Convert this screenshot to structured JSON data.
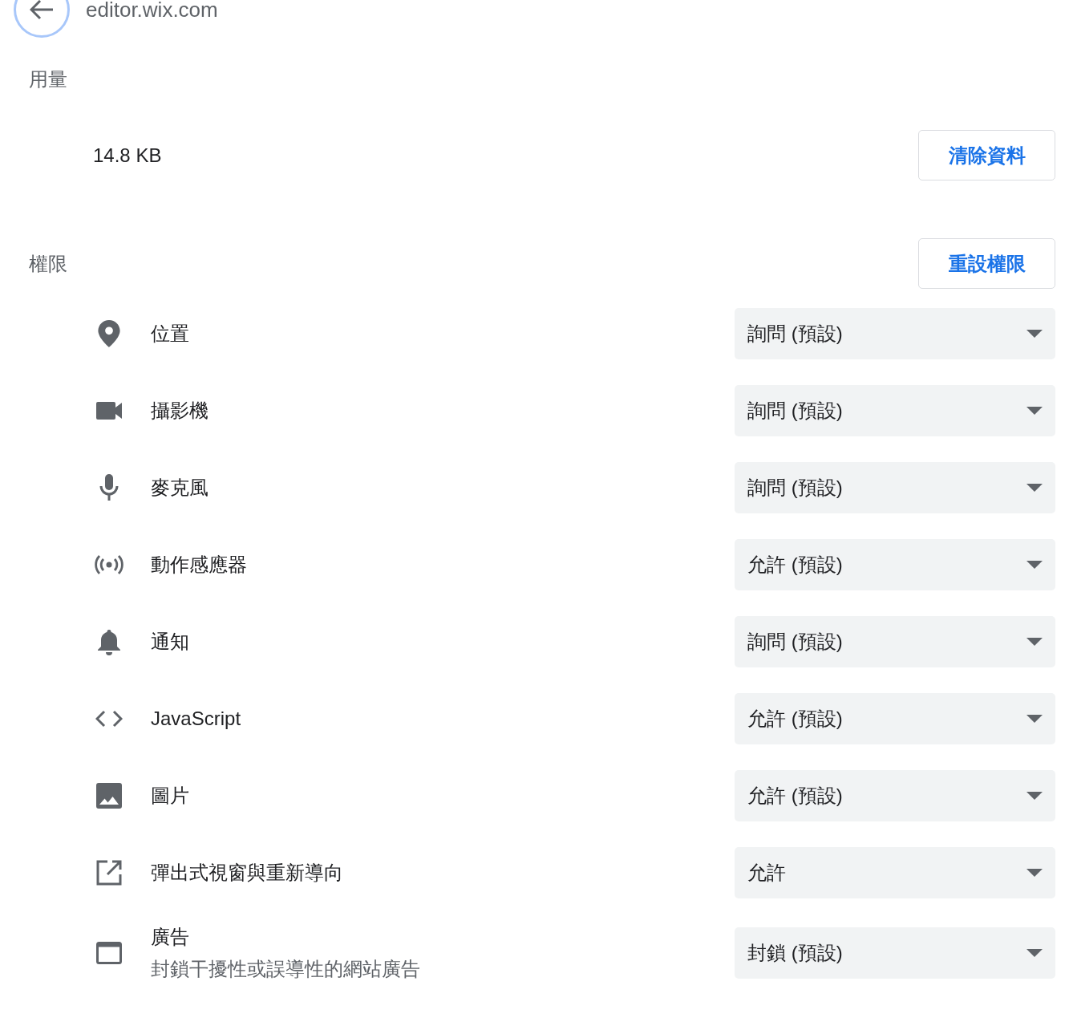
{
  "header": {
    "title": "editor.wix.com"
  },
  "usage": {
    "heading": "用量",
    "amount": "14.8 KB",
    "button": "清除資料"
  },
  "permissions": {
    "heading": "權限",
    "reset_button": "重設權限",
    "items": [
      {
        "label": "位置",
        "value": "詢問 (預設)"
      },
      {
        "label": "攝影機",
        "value": "詢問 (預設)"
      },
      {
        "label": "麥克風",
        "value": "詢問 (預設)"
      },
      {
        "label": "動作感應器",
        "value": "允許 (預設)"
      },
      {
        "label": "通知",
        "value": "詢問 (預設)"
      },
      {
        "label": "JavaScript",
        "value": "允許 (預設)"
      },
      {
        "label": "圖片",
        "value": "允許 (預設)"
      },
      {
        "label": "彈出式視窗與重新導向",
        "value": "允許"
      },
      {
        "label": "廣告",
        "description": "封鎖干擾性或誤導性的網站廣告",
        "value": "封鎖 (預設)"
      }
    ]
  }
}
